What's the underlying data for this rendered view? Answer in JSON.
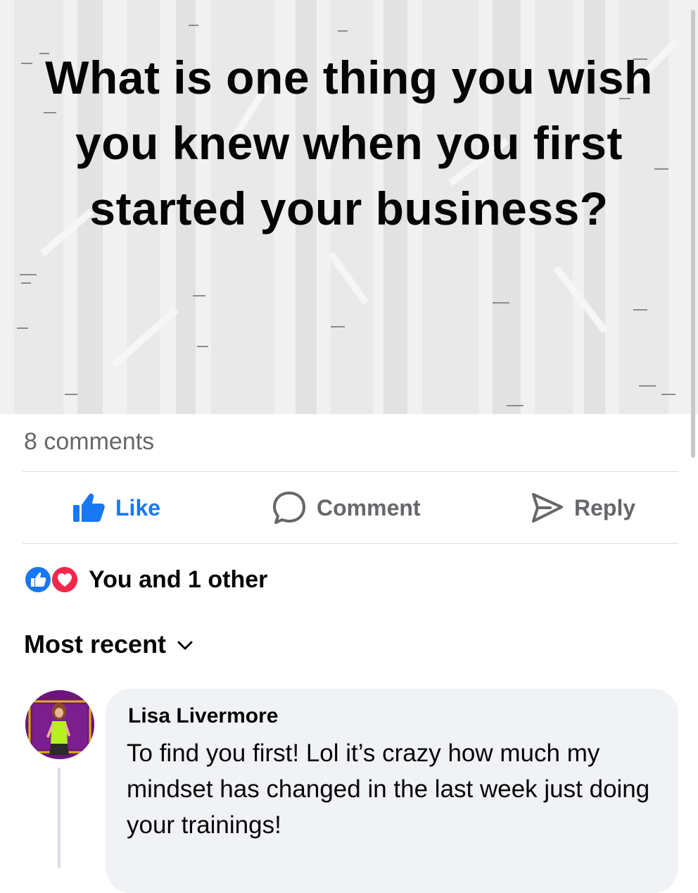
{
  "post": {
    "banner_text": "What is one thing you wish you knew when you first started your business?",
    "banner_background": "#f1f1f1",
    "comments_count": "8 comments"
  },
  "actions": {
    "like_label": "Like",
    "comment_label": "Comment",
    "reply_label": "Reply",
    "like_color": "#1877f2",
    "muted_color": "#65676b"
  },
  "reactions": {
    "icons": [
      "like-reaction-icon",
      "love-reaction-icon"
    ],
    "summary": "You and 1 other"
  },
  "sort": {
    "label": "Most recent",
    "icon": "chevron-down-icon"
  },
  "comments": [
    {
      "author": "Lisa Livermore",
      "text": "To find you first! Lol it’s crazy how much my mindset has changed in the last week just doing your trainings!"
    }
  ]
}
